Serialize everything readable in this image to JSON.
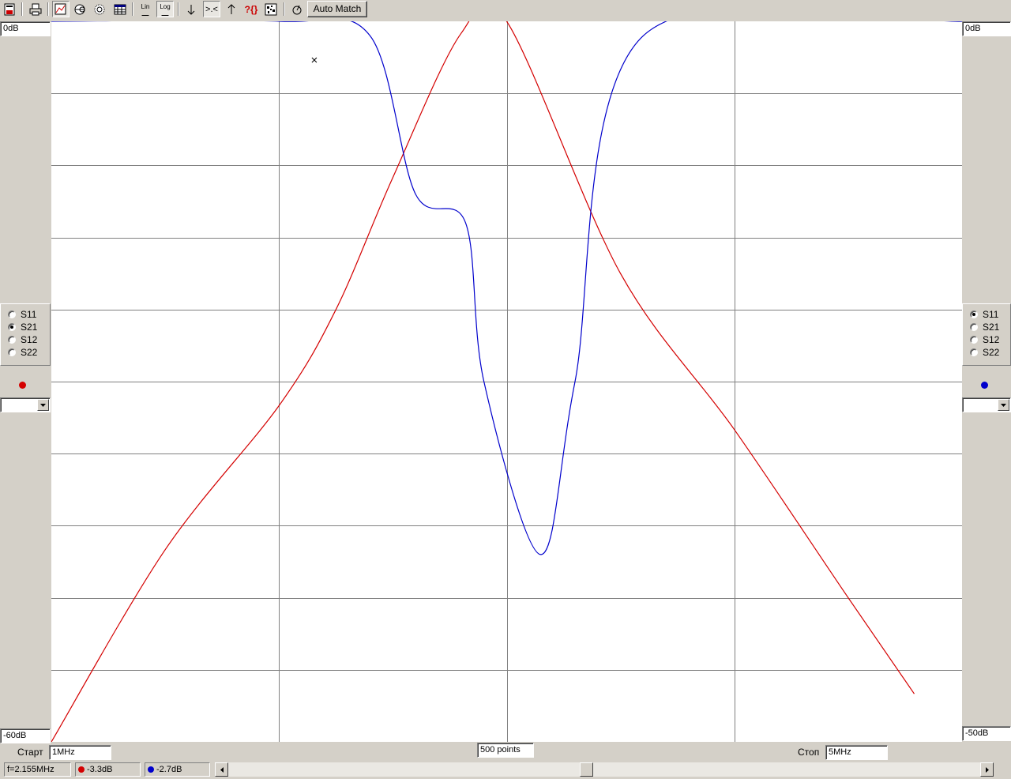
{
  "toolbar": {
    "buttons": [
      {
        "name": "save-icon"
      },
      {
        "name": "print-icon"
      },
      {
        "name": "cartesian-chart-icon"
      },
      {
        "name": "smith-chart-icon"
      },
      {
        "name": "polar-chart-icon"
      },
      {
        "name": "table-icon"
      },
      {
        "name": "linear-scale-icon",
        "text": "Lin"
      },
      {
        "name": "log-scale-icon",
        "text": "Log"
      },
      {
        "name": "marker-down-icon"
      },
      {
        "name": "marker-between-icon",
        "text": ">.<"
      },
      {
        "name": "marker-up-icon"
      },
      {
        "name": "help-icon",
        "text": "?{}"
      },
      {
        "name": "optimize-icon"
      },
      {
        "name": "tune-icon"
      }
    ],
    "auto_match_label": "Auto Match"
  },
  "left_axis": {
    "top": "0dB",
    "bottom": "-60dB"
  },
  "right_axis": {
    "top": "0dB",
    "bottom": "-50dB"
  },
  "left_params": {
    "options": [
      "S11",
      "S21",
      "S12",
      "S22"
    ],
    "selected": "S21",
    "trace_color": "#d40000"
  },
  "right_params": {
    "options": [
      "S11",
      "S21",
      "S12",
      "S22"
    ],
    "selected": "S11",
    "trace_color": "#0000cc"
  },
  "sweep": {
    "start_label": "Старт",
    "start_value": "1MHz",
    "points_value": "500 points",
    "stop_label": "Стоп",
    "stop_value": "5MHz"
  },
  "status": {
    "frequency": "f=2.155MHz",
    "left_value": "-3.3dB",
    "right_value": "-2.7dB"
  },
  "chart_data": {
    "type": "line",
    "x_range_mhz": [
      1,
      5
    ],
    "gridlines": {
      "vertical": 3,
      "horizontal": 10
    },
    "series": [
      {
        "axis": "left",
        "color": "#d40000",
        "ylim": [
          -60,
          0
        ],
        "x": [
          1.0,
          1.5,
          2.0,
          2.25,
          2.5,
          2.8,
          3.0,
          3.5,
          4.0,
          4.5,
          4.79
        ],
        "y": [
          -60,
          -44,
          -32,
          -24,
          -13,
          -1,
          0,
          -21,
          -34,
          -48,
          -56
        ]
      },
      {
        "axis": "right",
        "color": "#0000cc",
        "ylim": [
          -50,
          0
        ],
        "x": [
          1.0,
          2.0,
          2.4,
          2.6,
          2.82,
          2.9,
          3.15,
          3.3,
          3.6,
          5.0
        ],
        "y": [
          0,
          0,
          -1,
          -12,
          -14,
          -25,
          -37,
          -25,
          -1,
          0
        ]
      }
    ],
    "marker": {
      "x_mhz": 2.155
    }
  }
}
